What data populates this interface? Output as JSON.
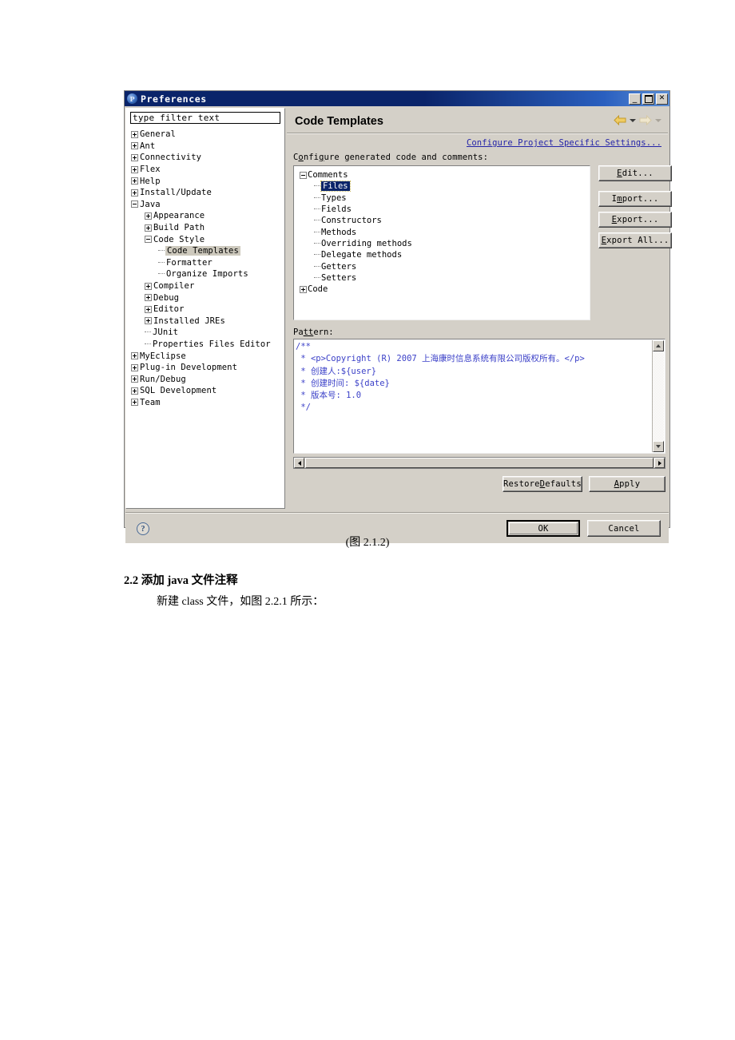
{
  "document": {
    "caption": "(图 2.1.2)",
    "heading": "2.2 添加 java 文件注释",
    "paragraph": "新建 class 文件，如图 2.2.1 所示："
  },
  "dialog": {
    "title": "Preferences",
    "window_buttons": {
      "minimize": "_",
      "maximize": "□",
      "close": "✕"
    },
    "filter": {
      "value": "type filter text",
      "placeholder": "type filter text"
    },
    "tree": [
      {
        "label": "General",
        "depth": 0,
        "expander": "plus"
      },
      {
        "label": "Ant",
        "depth": 0,
        "expander": "plus"
      },
      {
        "label": "Connectivity",
        "depth": 0,
        "expander": "plus"
      },
      {
        "label": "Flex",
        "depth": 0,
        "expander": "plus"
      },
      {
        "label": "Help",
        "depth": 0,
        "expander": "plus"
      },
      {
        "label": "Install/Update",
        "depth": 0,
        "expander": "plus"
      },
      {
        "label": "Java",
        "depth": 0,
        "expander": "minus"
      },
      {
        "label": "Appearance",
        "depth": 1,
        "expander": "plus"
      },
      {
        "label": "Build Path",
        "depth": 1,
        "expander": "plus"
      },
      {
        "label": "Code Style",
        "depth": 1,
        "expander": "minus"
      },
      {
        "label": "Code Templates",
        "depth": 2,
        "expander": "leaf",
        "selected": true
      },
      {
        "label": "Formatter",
        "depth": 2,
        "expander": "leaf"
      },
      {
        "label": "Organize Imports",
        "depth": 2,
        "expander": "leaf"
      },
      {
        "label": "Compiler",
        "depth": 1,
        "expander": "plus"
      },
      {
        "label": "Debug",
        "depth": 1,
        "expander": "plus"
      },
      {
        "label": "Editor",
        "depth": 1,
        "expander": "plus"
      },
      {
        "label": "Installed JREs",
        "depth": 1,
        "expander": "plus"
      },
      {
        "label": "JUnit",
        "depth": 1,
        "expander": "leaf"
      },
      {
        "label": "Properties Files Editor",
        "depth": 1,
        "expander": "leaf"
      },
      {
        "label": "MyEclipse",
        "depth": 0,
        "expander": "plus"
      },
      {
        "label": "Plug-in Development",
        "depth": 0,
        "expander": "plus"
      },
      {
        "label": "Run/Debug",
        "depth": 0,
        "expander": "plus"
      },
      {
        "label": "SQL Development",
        "depth": 0,
        "expander": "plus"
      },
      {
        "label": "Team",
        "depth": 0,
        "expander": "plus"
      }
    ],
    "page": {
      "title": "Code Templates",
      "configure_link": "Configure Project Specific Settings...",
      "configure_label_pre": "C",
      "configure_label_u1": "o",
      "configure_label_mid": "nfi",
      "configure_label_u2": "g",
      "configure_label_post": "ure generated code and comments:",
      "pattern_label_pre": "Pa",
      "pattern_label_u": "tt",
      "pattern_label_post": "ern:"
    },
    "templates_tree": [
      {
        "label": "Comments",
        "depth": 0,
        "expander": "minus"
      },
      {
        "label": "Files",
        "depth": 1,
        "expander": "leaf",
        "highlighted": true
      },
      {
        "label": "Types",
        "depth": 1,
        "expander": "leaf"
      },
      {
        "label": "Fields",
        "depth": 1,
        "expander": "leaf"
      },
      {
        "label": "Constructors",
        "depth": 1,
        "expander": "leaf"
      },
      {
        "label": "Methods",
        "depth": 1,
        "expander": "leaf"
      },
      {
        "label": "Overriding methods",
        "depth": 1,
        "expander": "leaf"
      },
      {
        "label": "Delegate methods",
        "depth": 1,
        "expander": "leaf"
      },
      {
        "label": "Getters",
        "depth": 1,
        "expander": "leaf"
      },
      {
        "label": "Setters",
        "depth": 1,
        "expander": "leaf"
      },
      {
        "label": "Code",
        "depth": 0,
        "expander": "plus"
      }
    ],
    "side_buttons": [
      {
        "pre": "",
        "key": "E",
        "post": "dit..."
      },
      {
        "pre": "I",
        "key": "m",
        "post": "port..."
      },
      {
        "pre": "",
        "key": "E",
        "post": "xport..."
      },
      {
        "pre": "",
        "key": "E",
        "post": "xport All..."
      }
    ],
    "pattern_text": "/**\n * <p>Copyright (R) 2007 上海康时信息系统有限公司版权所有。</p>\n * 创建人:${user}\n * 创建时间: ${date}\n * 版本号: 1.0\n */",
    "action_buttons": [
      {
        "pre": "Restore ",
        "key": "D",
        "post": "efaults"
      },
      {
        "pre": "",
        "key": "A",
        "post": "pply"
      }
    ],
    "footer_buttons": [
      {
        "label": "OK",
        "default": true
      },
      {
        "label": "Cancel",
        "default": false
      }
    ],
    "help_icon_label": "?"
  },
  "colors": {
    "titlebar_start": "#0a246a",
    "titlebar_end": "#5b8fd6",
    "dialog_face": "#d4d0c8",
    "selection": "#0a246a",
    "link": "#2424a8",
    "code_text": "#3b40c8",
    "tree_selected_bg": "#cdc9bd",
    "arrow_active": "#e8c34a",
    "arrow_inactive": "#e6ddc4"
  }
}
